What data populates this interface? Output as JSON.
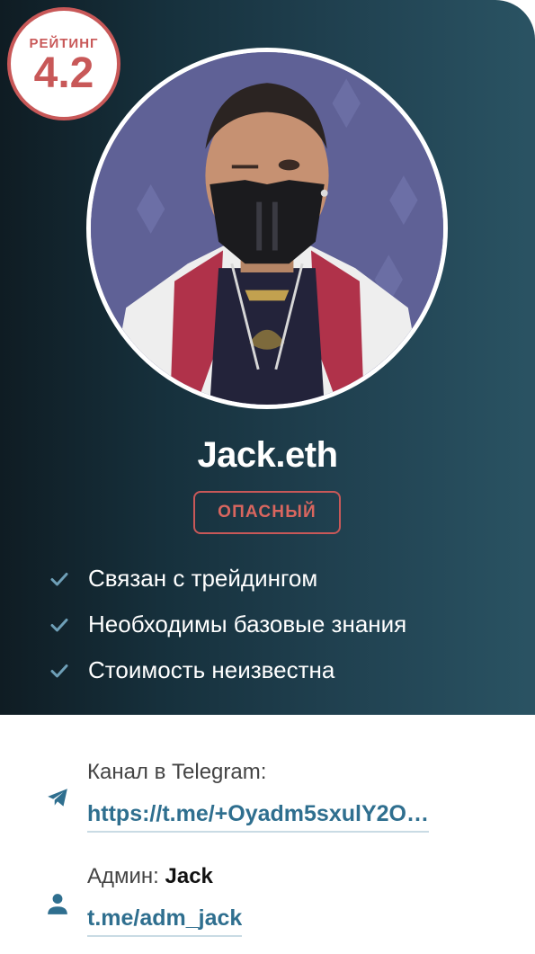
{
  "rating": {
    "label": "РЕЙТИНГ",
    "value": "4.2"
  },
  "profile": {
    "name": "Jack.eth",
    "badge": "ОПАСНЫЙ"
  },
  "features": [
    "Связан с трейдингом",
    "Необходимы базовые знания",
    "Стоимость неизвестна"
  ],
  "telegram": {
    "label": "Канал в Telegram:",
    "link": "https://t.me/+Oyadm5sxulY2O…",
    "icon": "telegram-plane-icon"
  },
  "admin": {
    "label_prefix": "Админ:",
    "name": "Jack",
    "link": "t.me/adm_jack",
    "icon": "user-icon"
  },
  "colors": {
    "accent_red": "#c85858",
    "link_blue": "#2f6f8f",
    "card_dark": "#16303c"
  }
}
